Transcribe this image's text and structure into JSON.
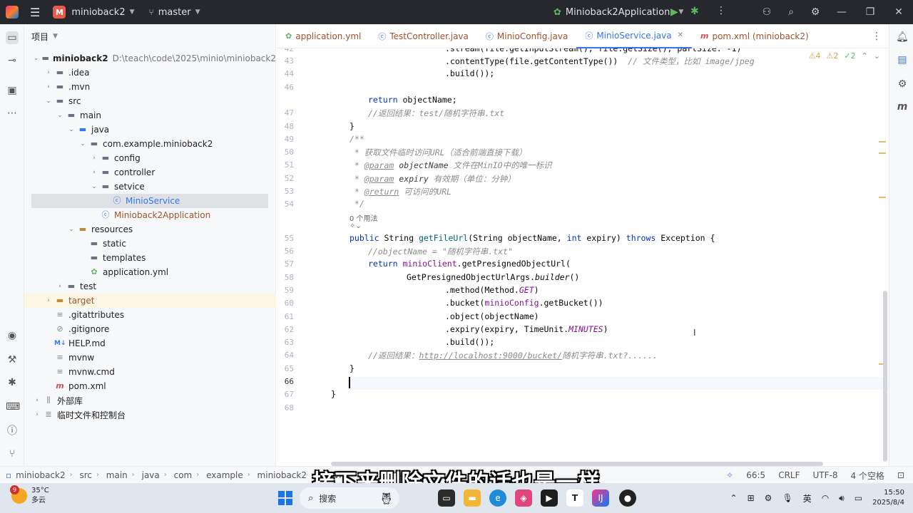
{
  "titlebar": {
    "project_badge": "M",
    "project_name": "minioback2",
    "branch": "master",
    "run_config": "Minioback2Application"
  },
  "project_panel": {
    "header": "项目",
    "tree": [
      {
        "label": "minioback2",
        "path": "D:\\teach\\code\\2025\\minio\\minioback2"
      },
      {
        "label": ".idea"
      },
      {
        "label": ".mvn"
      },
      {
        "label": "src"
      },
      {
        "label": "main"
      },
      {
        "label": "java"
      },
      {
        "label": "com.example.minioback2"
      },
      {
        "label": "config"
      },
      {
        "label": "controller"
      },
      {
        "label": "setvice"
      },
      {
        "label": "MinioService"
      },
      {
        "label": "Minioback2Application"
      },
      {
        "label": "resources"
      },
      {
        "label": "static"
      },
      {
        "label": "templates"
      },
      {
        "label": "application.yml"
      },
      {
        "label": "test"
      },
      {
        "label": "target"
      },
      {
        "label": ".gitattributes"
      },
      {
        "label": ".gitignore"
      },
      {
        "label": "HELP.md"
      },
      {
        "label": "mvnw"
      },
      {
        "label": "mvnw.cmd"
      },
      {
        "label": "pom.xml"
      },
      {
        "label": "外部库"
      },
      {
        "label": "临时文件和控制台"
      }
    ]
  },
  "tabs": [
    {
      "label": "application.yml"
    },
    {
      "label": "TestController.java"
    },
    {
      "label": "MinioConfig.java"
    },
    {
      "label": "MinioService.java"
    },
    {
      "label": "pom.xml (minioback2)"
    }
  ],
  "editor": {
    "problems": {
      "warnings": "4",
      "weak": "2",
      "ok": "2"
    },
    "hint_usages": "0 个用法",
    "line_numbers": [
      "42",
      "43",
      "44",
      "46",
      "47",
      "48",
      "49",
      "50",
      "51",
      "52",
      "53",
      "54",
      "55",
      "56",
      "57",
      "58",
      "59",
      "60",
      "61",
      "62",
      "63",
      "64",
      "65",
      "66",
      "67",
      "68"
    ]
  },
  "statusbar": {
    "breadcrumb": [
      "minioback2",
      "src",
      "main",
      "java",
      "com",
      "example",
      "minioback2",
      "setvi"
    ],
    "position": "66:5",
    "line_sep": "CRLF",
    "encoding": "UTF-8",
    "indent": "4 个空格"
  },
  "subtitle": "接下来删除文件的话也是一样",
  "taskbar": {
    "weather_badge": "9",
    "temperature": "35°C",
    "condition": "多云",
    "search_label": "搜索",
    "ime": "英",
    "time": "15:50",
    "date": "2025/8/4"
  }
}
